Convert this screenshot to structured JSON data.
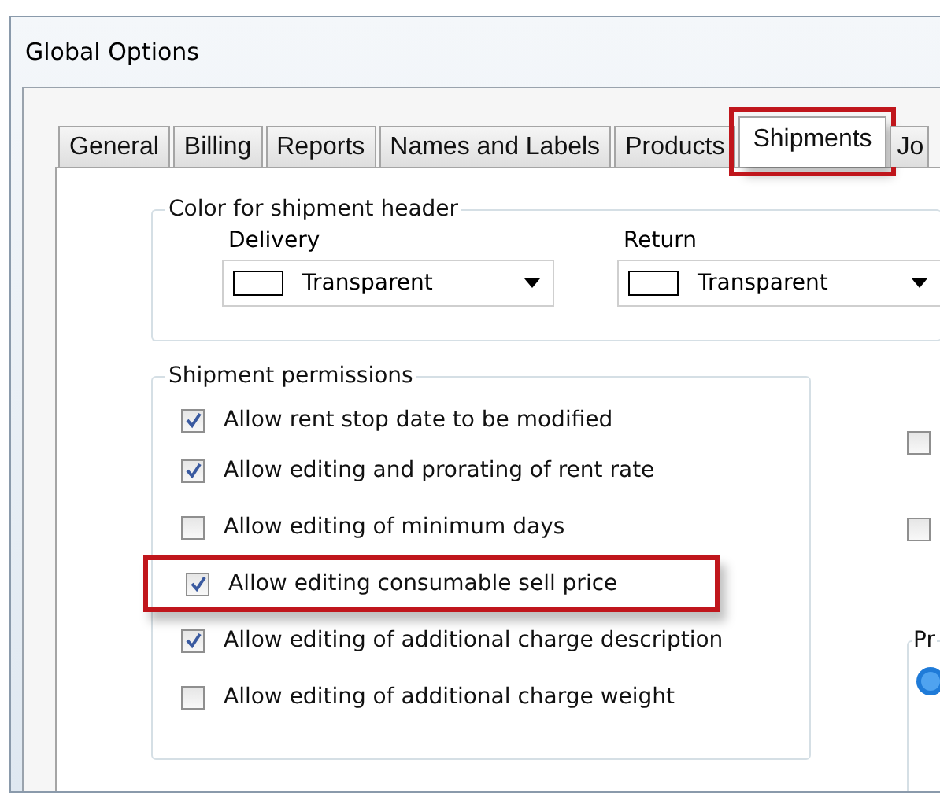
{
  "window": {
    "title": "Global Options"
  },
  "tabs": [
    {
      "label": "General",
      "selected": false,
      "highlighted": false
    },
    {
      "label": "Billing",
      "selected": false,
      "highlighted": false
    },
    {
      "label": "Reports",
      "selected": false,
      "highlighted": false
    },
    {
      "label": "Names and Labels",
      "selected": false,
      "highlighted": false
    },
    {
      "label": "Products",
      "selected": false,
      "highlighted": false
    },
    {
      "label": "Shipments",
      "selected": true,
      "highlighted": true
    },
    {
      "label": "Jo",
      "selected": false,
      "highlighted": false
    }
  ],
  "color_group": {
    "title": "Color for shipment header",
    "dropdowns": [
      {
        "label": "Delivery",
        "value": "Transparent"
      },
      {
        "label": "Return",
        "value": "Transparent"
      }
    ]
  },
  "permissions": {
    "title": "Shipment permissions",
    "items": [
      {
        "label": "Allow rent stop date to be modified",
        "checked": true,
        "highlighted": false
      },
      {
        "label": "Allow editing and prorating of rent rate",
        "checked": true,
        "highlighted": false
      },
      {
        "label": "Allow editing of minimum days",
        "checked": false,
        "highlighted": false
      },
      {
        "label": "Allow editing consumable sell price",
        "checked": true,
        "highlighted": true
      },
      {
        "label": "Allow editing of additional charge description",
        "checked": true,
        "highlighted": false
      },
      {
        "label": "Allow editing of additional charge weight",
        "checked": false,
        "highlighted": false
      }
    ]
  },
  "right_column": {
    "checkboxes": [
      {
        "checked": false
      },
      {
        "checked": false
      }
    ],
    "group_title": "Pr"
  }
}
